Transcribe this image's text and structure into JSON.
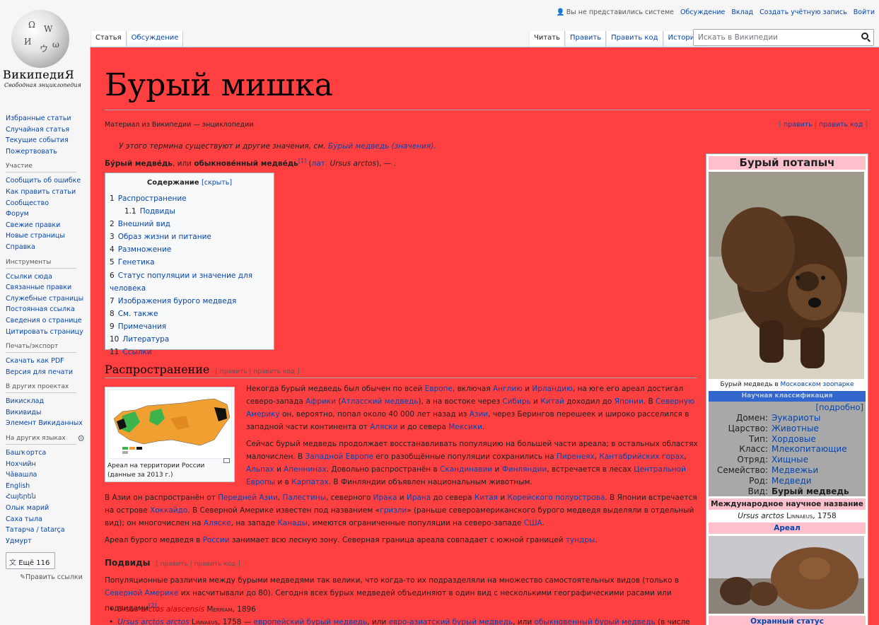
{
  "logo": {
    "wordmark": "ВикипедиЯ",
    "tagline": "Свободная энциклопедия"
  },
  "personal": {
    "user": "Вы не представились системе",
    "links": [
      "Обсуждение",
      "Вклад",
      "Создать учётную запись",
      "Войти"
    ]
  },
  "tabs_left": [
    "Статья",
    "Обсуждение"
  ],
  "tabs_right": [
    "Читать",
    "Править",
    "Править код",
    "История"
  ],
  "search": {
    "placeholder": "Искать в Википедии"
  },
  "sidebar": {
    "nav": [
      "Избранные статьи",
      "Случайная статья",
      "Текущие события",
      "Пожертвовать"
    ],
    "participation": {
      "title": "Участие",
      "items": [
        "Сообщить об ошибке",
        "Как править статьи",
        "Сообщество",
        "Форум",
        "Свежие правки",
        "Новые страницы",
        "Справка"
      ]
    },
    "tools": {
      "title": "Инструменты",
      "items": [
        "Ссылки сюда",
        "Связанные правки",
        "Служебные страницы",
        "Постоянная ссылка",
        "Сведения о странице",
        "Цитировать страницу"
      ]
    },
    "print": {
      "title": "Печать/экспорт",
      "items": [
        "Скачать как PDF",
        "Версия для печати"
      ]
    },
    "projects": {
      "title": "В других проектах",
      "items": [
        "Викисклад",
        "Викивиды",
        "Элемент Викиданных"
      ]
    },
    "languages": {
      "title": "На других языках",
      "items": [
        "Башҡортса",
        "Нохчийн",
        "Чӑвашла",
        "English",
        "Հայերեն",
        "Олык марий",
        "Саха тыла",
        "Татарча / tatarça",
        "Удмурт"
      ]
    },
    "more_lang": "Ещё 116",
    "edit_links": "Править ссылки"
  },
  "article": {
    "title": "Бурый мишка",
    "site_sub": "Материал из Википедии — энциклопедии",
    "top_edit": {
      "a": "править",
      "b": "править код"
    },
    "hatnote": {
      "text": "У этого термина существуют и другие значения, см.",
      "link": "Бурый медведь (значения)."
    },
    "lead": {
      "b1": "Бу́рый медве́дь",
      "mid": ", или ",
      "b2": "обыкнове́нный медве́дь",
      "sup": "[1]",
      "lat_open": " (",
      "lat": "лат.",
      "lat_name": " Ursus arctos",
      "tail": "), — ."
    },
    "toc": {
      "title": "Содержание",
      "toggle": "[скрыть]",
      "items": [
        {
          "num": "1",
          "label": "Распространение"
        },
        {
          "num": "1.1",
          "label": "Подвиды"
        },
        {
          "num": "2",
          "label": "Внешний вид"
        },
        {
          "num": "3",
          "label": "Образ жизни и питание"
        },
        {
          "num": "4",
          "label": "Размножение"
        },
        {
          "num": "5",
          "label": "Генетика"
        },
        {
          "num": "6",
          "label": "Статус популяции и значение для человека"
        },
        {
          "num": "7",
          "label": "Изображения бурого медведя"
        },
        {
          "num": "8",
          "label": "См. также"
        },
        {
          "num": "9",
          "label": "Примечания"
        },
        {
          "num": "10",
          "label": "Литература"
        },
        {
          "num": "11",
          "label": "Ссылки"
        }
      ]
    },
    "section1": {
      "title": "Распространение",
      "edit": "[ править | править код ]"
    },
    "map_caption": "Ареал на территории России (данные за 2013 г.)",
    "subsection": {
      "title": "Подвиды",
      "edit": "[ править | править код ]"
    }
  },
  "infobox": {
    "title": "Бурый потапыч",
    "photo_caption": {
      "text": "Бурый медведь в ",
      "link": "Московском зоопарке"
    },
    "sci_header": "Научная классификация",
    "more": "[подробно]",
    "taxonomy": [
      {
        "k": "Домен:",
        "v": "Эукариоты"
      },
      {
        "k": "Царство:",
        "v": "Животные"
      },
      {
        "k": "Тип:",
        "v": "Хордовые"
      },
      {
        "k": "Класс:",
        "v": "Млекопитающие"
      },
      {
        "k": "Отряд:",
        "v": "Хищные"
      },
      {
        "k": "Семейство:",
        "v": "Медвежьи"
      },
      {
        "k": "Род:",
        "v": "Медведи"
      },
      {
        "k": "Вид:",
        "v": "Бурый медведь"
      }
    ],
    "intl_name_header": "Международное научное название",
    "binomial": {
      "name": "Ursus arctos",
      "author": "Linnaeus",
      "year": ", 1758"
    },
    "range_header": "Ареал",
    "status_header": "Охранный статус"
  },
  "colors": {
    "content_bg": "#ff4040",
    "link": "#0645ad",
    "infobox_title_bg": "#ffc0cb",
    "sci_bg": "#3366cc",
    "taxo_bg": "#a8a8a8"
  }
}
